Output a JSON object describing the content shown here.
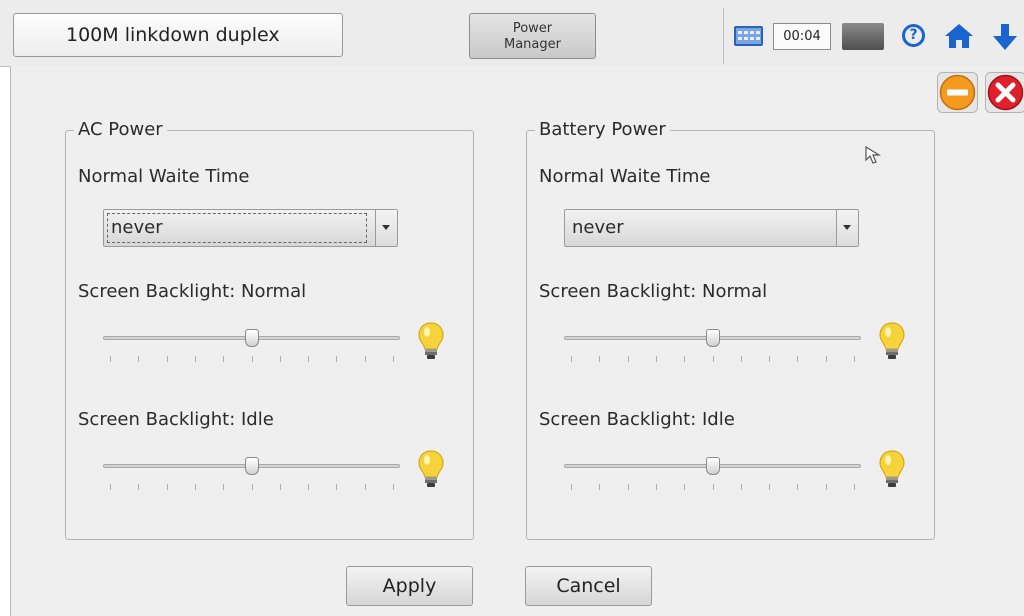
{
  "header": {
    "status_text": "100M linkdown duplex",
    "power_manager_line1": "Power",
    "power_manager_line2": "Manager",
    "clock": "00:04",
    "icons": [
      "keyboard-icon",
      "battery-icon",
      "help-icon",
      "home-icon",
      "arrow-down-icon"
    ]
  },
  "window_controls": {
    "minimize_icon": "minimize-icon",
    "close_icon": "close-icon",
    "colors": {
      "minimize": "#f39a1f",
      "close": "#e0202a"
    }
  },
  "ac_power": {
    "title": "AC Power",
    "wait_label": "Normal Waite Time",
    "wait_value": "never",
    "backlight_normal_label": "Screen Backlight: Normal",
    "backlight_normal_level": 0.5,
    "backlight_idle_label": "Screen Backlight: Idle",
    "backlight_idle_level": 0.5
  },
  "battery_power": {
    "title": "Battery Power",
    "wait_label": "Normal Waite Time",
    "wait_value": "never",
    "backlight_normal_label": "Screen Backlight: Normal",
    "backlight_normal_level": 0.5,
    "backlight_idle_label": "Screen Backlight: Idle",
    "backlight_idle_level": 0.5
  },
  "actions": {
    "apply_label": "Apply",
    "cancel_label": "Cancel"
  }
}
